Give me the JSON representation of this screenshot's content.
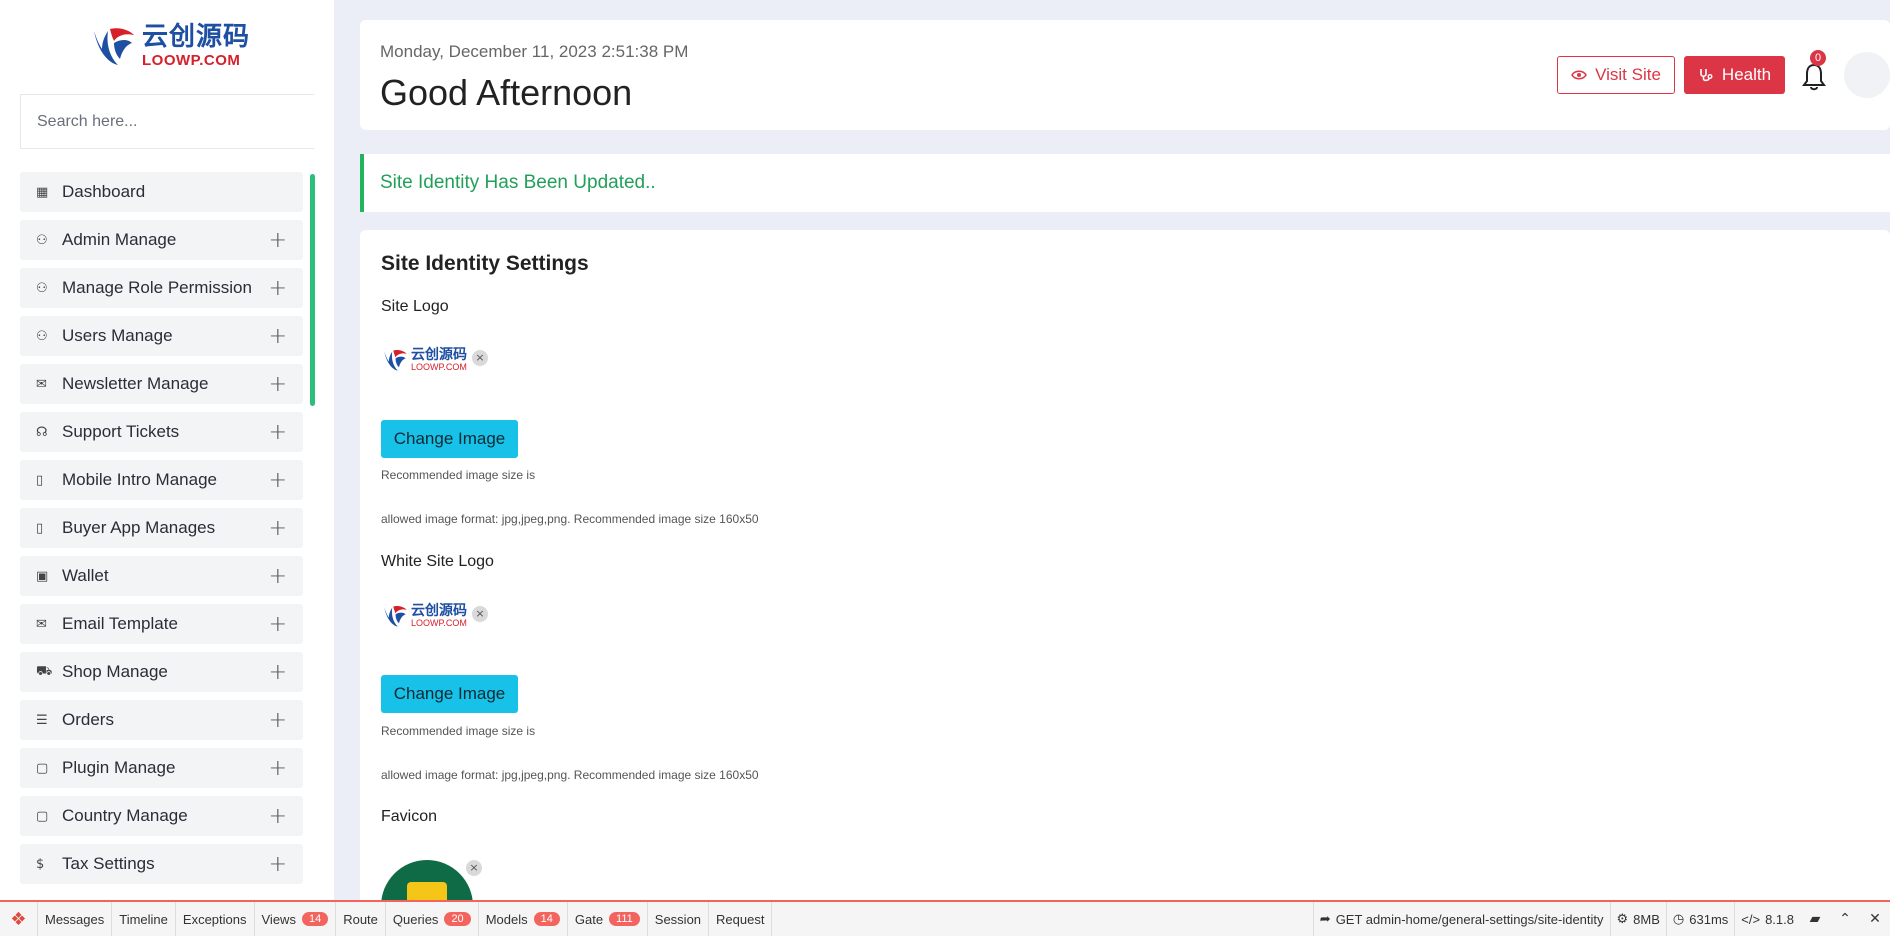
{
  "brand": {
    "logo_cn": "云创源码",
    "logo_en": "LOOWP.COM",
    "primary_color": "#1e4fa3",
    "accent_color": "#d6202a"
  },
  "sidebar": {
    "search_placeholder": "Search here...",
    "items": [
      {
        "label": "Dashboard",
        "icon": "dashboard-icon",
        "glyph": "▦",
        "expandable": false
      },
      {
        "label": "Admin Manage",
        "icon": "user-icon",
        "glyph": "⚇",
        "expandable": true
      },
      {
        "label": "Manage Role Permission",
        "icon": "user-icon",
        "glyph": "⚇",
        "expandable": true
      },
      {
        "label": "Users Manage",
        "icon": "user-icon",
        "glyph": "⚇",
        "expandable": true
      },
      {
        "label": "Newsletter Manage",
        "icon": "envelope-icon",
        "glyph": "✉",
        "expandable": true
      },
      {
        "label": "Support Tickets",
        "icon": "headset-icon",
        "glyph": "☊",
        "expandable": true
      },
      {
        "label": "Mobile Intro Manage",
        "icon": "mobile-icon",
        "glyph": "▯",
        "expandable": true
      },
      {
        "label": "Buyer App Manages",
        "icon": "mobile-icon",
        "glyph": "▯",
        "expandable": true
      },
      {
        "label": "Wallet",
        "icon": "wallet-icon",
        "glyph": "▣",
        "expandable": true
      },
      {
        "label": "Email Template",
        "icon": "envelope-icon",
        "glyph": "✉",
        "expandable": true
      },
      {
        "label": "Shop Manage",
        "icon": "cart-icon",
        "glyph": "⛟",
        "expandable": true
      },
      {
        "label": "Orders",
        "icon": "list-icon",
        "glyph": "☰",
        "expandable": true
      },
      {
        "label": "Plugin Manage",
        "icon": "clipboard-icon",
        "glyph": "▢",
        "expandable": true
      },
      {
        "label": "Country Manage",
        "icon": "clipboard-icon",
        "glyph": "▢",
        "expandable": true
      },
      {
        "label": "Tax Settings",
        "icon": "dollar-icon",
        "glyph": "$",
        "expandable": true
      }
    ],
    "plus_glyph": "+"
  },
  "header": {
    "datetime": "Monday, December 11, 2023 2:51:38 PM",
    "greeting": "Good Afternoon",
    "visit_site_label": "Visit Site",
    "health_label": "Health",
    "notification_count": "0",
    "danger_color": "#dc3545"
  },
  "alert": {
    "message": "Site Identity Has Been Updated..",
    "color": "#22a05a"
  },
  "settings": {
    "title": "Site Identity Settings",
    "site_logo_label": "Site Logo",
    "white_logo_label": "White Site Logo",
    "favicon_label": "Favicon",
    "change_image_label": "Change Image",
    "recommended_text": "Recommended image size is",
    "allowed_format_text": "allowed image format: jpg,jpeg,png. Recommended image size 160x50",
    "remove_glyph": "×",
    "thumb_cn": "云创源码",
    "thumb_en": "LOOWP.COM",
    "button_color": "#17c1e8"
  },
  "debugbar": {
    "tabs": [
      {
        "label": "Messages",
        "badge": ""
      },
      {
        "label": "Timeline",
        "badge": ""
      },
      {
        "label": "Exceptions",
        "badge": ""
      },
      {
        "label": "Views",
        "badge": "14"
      },
      {
        "label": "Route",
        "badge": ""
      },
      {
        "label": "Queries",
        "badge": "20"
      },
      {
        "label": "Models",
        "badge": "14"
      },
      {
        "label": "Gate",
        "badge": "111"
      },
      {
        "label": "Session",
        "badge": ""
      },
      {
        "label": "Request",
        "badge": ""
      }
    ],
    "route": "GET admin-home/general-settings/site-identity",
    "memory": "8MB",
    "time": "631ms",
    "php_version": "8.1.8"
  }
}
